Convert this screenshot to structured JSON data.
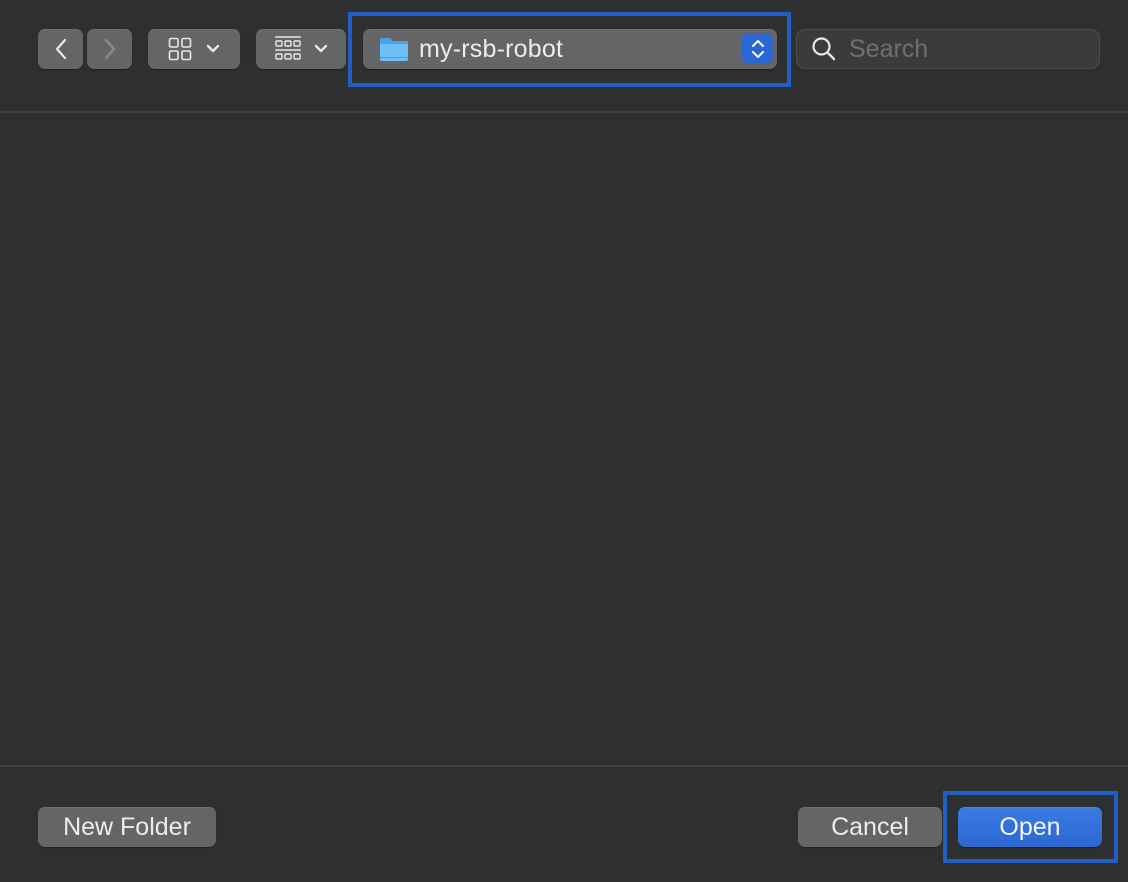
{
  "toolbar": {
    "back_icon": "chevron-left-icon",
    "forward_icon": "chevron-right-icon",
    "view_mode_icon": "icon-grid-icon",
    "group_mode_icon": "group-grid-icon",
    "location": {
      "folder_icon": "folder-icon",
      "label": "my-rsb-robot",
      "stepper_icon": "up-down-chevron-icon"
    },
    "search": {
      "placeholder": "Search",
      "value": ""
    }
  },
  "footer": {
    "new_folder_label": "New Folder",
    "cancel_label": "Cancel",
    "open_label": "Open"
  },
  "colors": {
    "background": "#2e2f31",
    "button": "#656567",
    "accent": "#2a67d4",
    "focus_ring": "#1f5fc2"
  }
}
